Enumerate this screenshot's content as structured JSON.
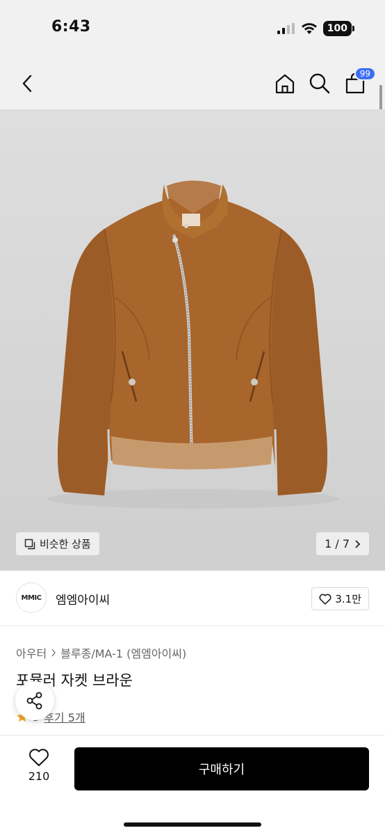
{
  "status_bar": {
    "time": "6:43",
    "battery": "100"
  },
  "header": {
    "cart_badge": "99"
  },
  "gallery": {
    "similar_label": "비슷한 상품",
    "pager": "1 / 7"
  },
  "brand": {
    "logo_text": "MMIC",
    "name": "엠엠아이씨",
    "likes": "3.1만"
  },
  "product": {
    "breadcrumb_1": "아우터",
    "breadcrumb_2": "블루종/MA-1 (엠엠아이씨)",
    "title": "포뮬러 자켓 브라운",
    "rating": "5",
    "review_link": "후기 5개"
  },
  "bottom_bar": {
    "wish_count": "210",
    "buy_label": "구매하기"
  },
  "colors": {
    "badge": "#3b6ef5",
    "buy_button": "#000000",
    "star": "#f5a623",
    "jacket": "#a8652c"
  }
}
